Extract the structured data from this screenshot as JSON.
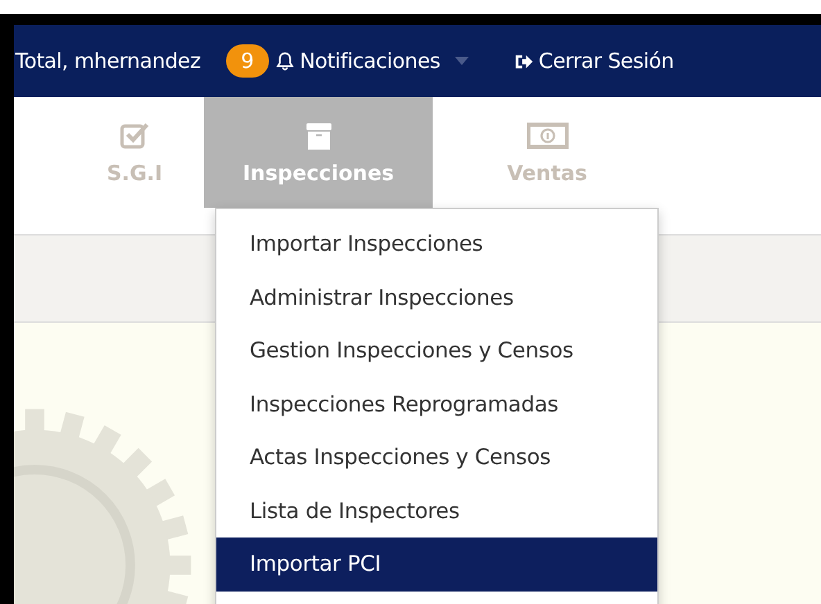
{
  "top_bar": {
    "user": "Total, mhernandez",
    "notification_count": "9",
    "notifications": "Notificaciones",
    "logout": "Cerrar Sesión"
  },
  "tabs": [
    {
      "label": "S.G.I",
      "kind": "check",
      "selected": false
    },
    {
      "label": "Inspecciones",
      "kind": "box",
      "selected": true
    },
    {
      "label": "Ventas",
      "kind": "money",
      "selected": false
    }
  ],
  "dropdown": {
    "items": [
      {
        "label": "Importar Inspecciones",
        "selected": false
      },
      {
        "label": "Administrar Inspecciones",
        "selected": false
      },
      {
        "label": "Gestion Inspecciones y Censos",
        "selected": false
      },
      {
        "label": "Inspecciones Reprogramadas",
        "selected": false
      },
      {
        "label": "Actas Inspecciones y Censos",
        "selected": false
      },
      {
        "label": "Lista de Inspectores",
        "selected": false
      },
      {
        "label": "Importar PCI",
        "selected": true
      }
    ]
  }
}
